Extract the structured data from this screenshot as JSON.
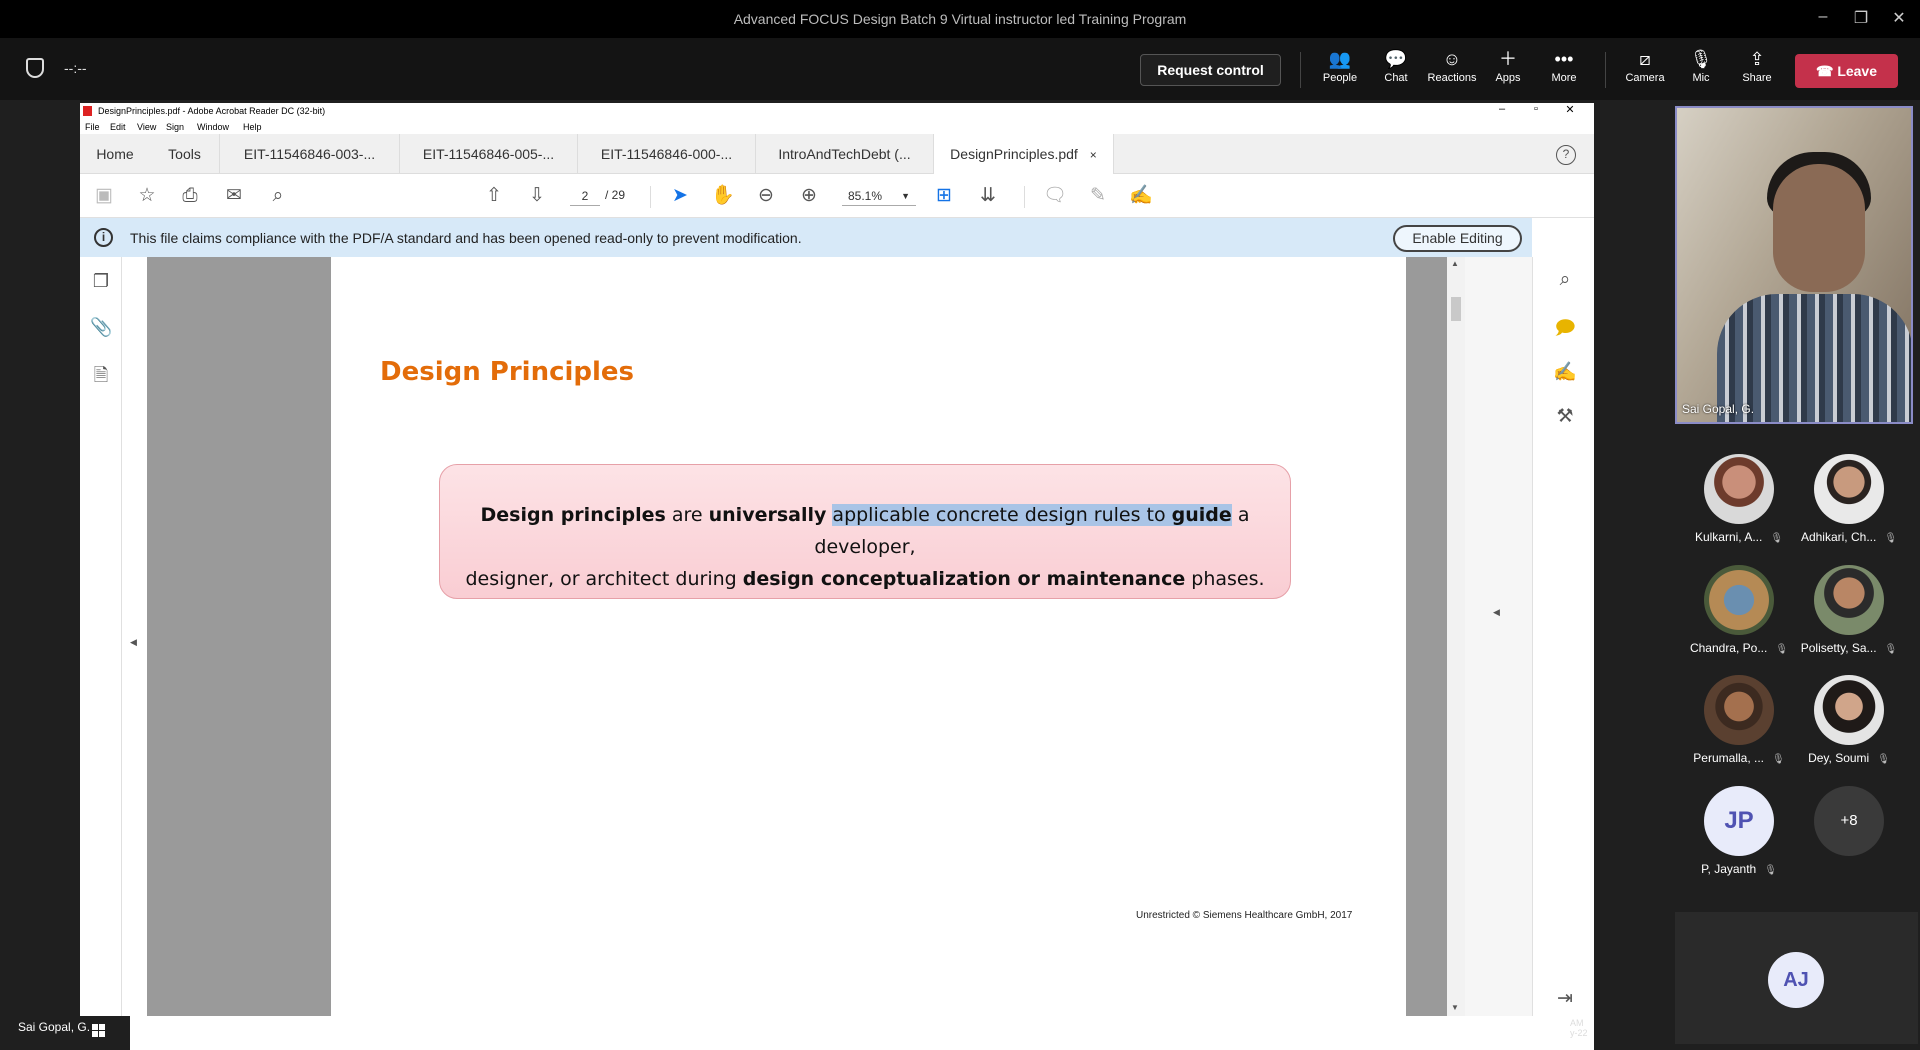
{
  "teams": {
    "window_title": "Advanced FOCUS Design Batch 9 Virtual instructor led Training Program",
    "timer": "--:--",
    "request_control": "Request control",
    "buttons": {
      "people": "People",
      "chat": "Chat",
      "reactions": "Reactions",
      "apps": "Apps",
      "more": "More",
      "camera": "Camera",
      "mic": "Mic",
      "share": "Share",
      "leave": "Leave"
    },
    "video_name": "Sai Gopal, G.",
    "participants": [
      {
        "name": "Kulkarni, A..."
      },
      {
        "name": "Adhikari, Ch..."
      },
      {
        "name": "Chandra, Po..."
      },
      {
        "name": "Polisetty, Sa..."
      },
      {
        "name": "Perumalla, ..."
      },
      {
        "name": "Dey, Soumi"
      },
      {
        "name": "P, Jayanth",
        "initials": "JP"
      },
      {
        "name": "",
        "more": "+8"
      }
    ],
    "aj_initials": "AJ",
    "bottom_name": "Sai Gopal, G.",
    "clock_line1": "AM",
    "clock_line2": "y-22"
  },
  "acrobat": {
    "window_title": "DesignPrinciples.pdf - Adobe Acrobat Reader DC (32-bit)",
    "menu": [
      "File",
      "Edit",
      "View",
      "Sign",
      "Window",
      "Help"
    ],
    "nav_tabs": [
      "Home",
      "Tools"
    ],
    "doc_tabs": [
      "EIT-11546846-003-...",
      "EIT-11546846-005-...",
      "EIT-11546846-000-...",
      "IntroAndTechDebt (...",
      "DesignPrinciples.pdf"
    ],
    "active_tab_close": "×",
    "page_current": "2",
    "page_total": "/ 29",
    "zoom": "85.1%",
    "info_message": "This file claims compliance with the PDF/A standard and has been opened read-only to prevent modification.",
    "enable_editing": "Enable Editing"
  },
  "document": {
    "title": "Design Principles",
    "def_part1": "Design principles",
    "def_part2": " are ",
    "def_part3": "universally",
    "def_part4": " ",
    "def_highlight1": "applicable concrete design rules to ",
    "def_highlight2": "guide",
    "def_part5": " a developer,",
    "def_line2a": "designer, or architect during ",
    "def_line2b": "design conceptualization or maintenance",
    "def_line2c": " phases.",
    "footer": "Unrestricted © Siemens Healthcare GmbH, 2017"
  },
  "colors": {
    "title_orange": "#e36c09",
    "leave_red": "#c4314b",
    "info_blue": "#d7e9f8",
    "highlight": "#a9c4e6"
  }
}
